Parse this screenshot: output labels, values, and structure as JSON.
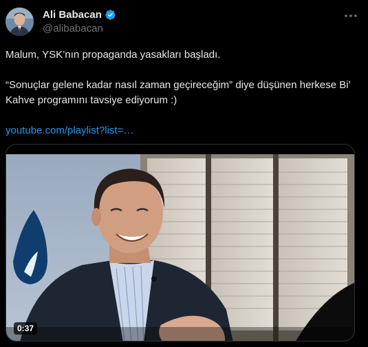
{
  "author": {
    "display_name": "Ali Babacan",
    "handle": "@alibabacan",
    "verified": true
  },
  "tweet": {
    "line1": "Malum, YSK’nın propaganda yasakları başladı.",
    "line2": "“Sonuçlar gelene kadar nasıl zaman geçireceğim” diye düşünen herkese Bi’ Kahve programını tavsiye ediyorum :)",
    "link_text": "youtube.com/playlist?list=…"
  },
  "media": {
    "duration": "0:37",
    "play_icon": "video-thumbnail"
  },
  "icons": {
    "verified": "verified-badge-icon",
    "more": "more-options-icon"
  },
  "colors": {
    "background": "#000000",
    "text": "#e7e9ea",
    "secondary": "#71767b",
    "link": "#1d9bf0",
    "verified": "#1d9bf0",
    "border": "#2f3336"
  }
}
